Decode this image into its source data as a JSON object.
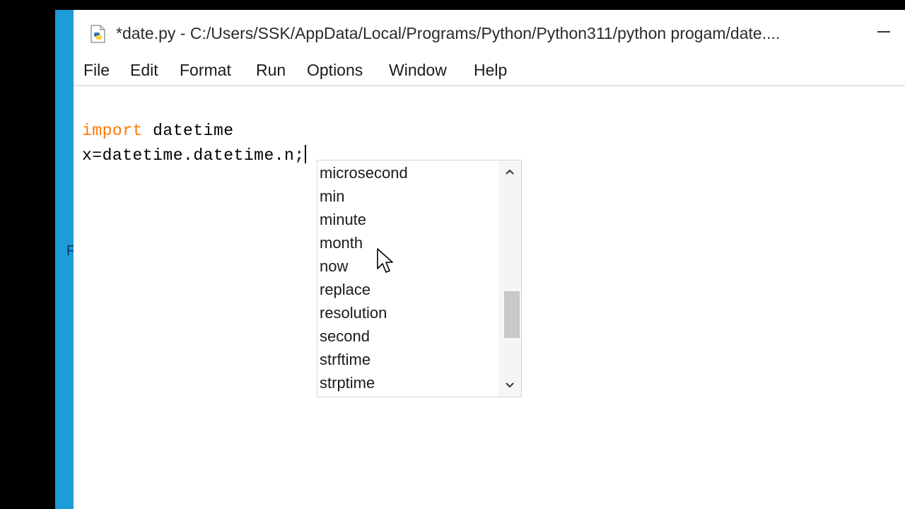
{
  "window": {
    "title": "*date.py - C:/Users/SSK/AppData/Local/Programs/Python/Python311/python progam/date....",
    "edge_glyph": "F"
  },
  "menu": {
    "file": "File",
    "edit": "Edit",
    "format": "Format",
    "run": "Run",
    "options": "Options",
    "window": "Window",
    "help": "Help"
  },
  "editor": {
    "line1_keyword": "import",
    "line1_rest": " datetime",
    "line2": "x=datetime.datetime.n;"
  },
  "completion": {
    "items": [
      "microsecond",
      "min",
      "minute",
      "month",
      "now",
      "replace",
      "resolution",
      "second",
      "strftime",
      "strptime"
    ]
  },
  "colors": {
    "keyword": "#ff7700",
    "window_accent": "#1e9bd9"
  },
  "icons": {
    "app": "python-file-icon",
    "minimize": "minimize-icon",
    "scroll_up": "chevron-up-icon",
    "scroll_down": "chevron-down-icon",
    "cursor": "mouse-pointer-icon"
  }
}
